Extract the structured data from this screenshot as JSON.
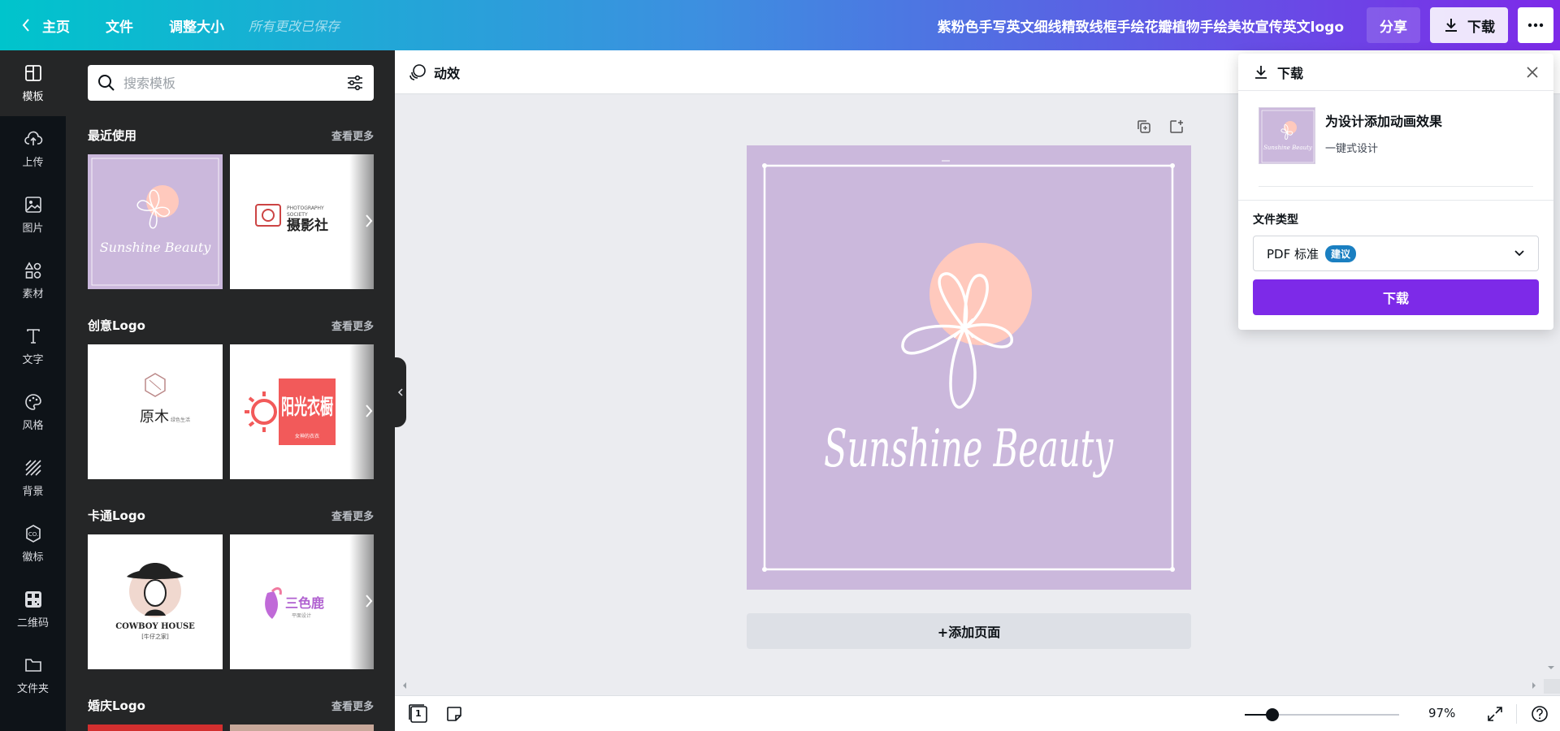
{
  "topbar": {
    "home": "主页",
    "file": "文件",
    "resize": "调整大小",
    "saved": "所有更改已保存",
    "doc_title": "紫粉色手写英文细线精致线框手绘花瓣植物手绘美妆宣传英文logo",
    "share": "分享",
    "download": "下载",
    "more_icon": "more-icon"
  },
  "rail": {
    "items": [
      {
        "label": "模板",
        "icon": "template-icon"
      },
      {
        "label": "上传",
        "icon": "upload-icon"
      },
      {
        "label": "图片",
        "icon": "image-icon"
      },
      {
        "label": "素材",
        "icon": "elements-icon"
      },
      {
        "label": "文字",
        "icon": "text-icon"
      },
      {
        "label": "风格",
        "icon": "palette-icon"
      },
      {
        "label": "背景",
        "icon": "background-icon"
      },
      {
        "label": "徽标",
        "icon": "logo-icon"
      },
      {
        "label": "二维码",
        "icon": "qrcode-icon"
      },
      {
        "label": "文件夹",
        "icon": "folder-icon"
      }
    ]
  },
  "panel": {
    "search_placeholder": "搜索模板",
    "see_more": "查看更多",
    "sections": [
      {
        "title": "最近使用",
        "thumbs": [
          {
            "text": "Sunshine Beauty"
          },
          {
            "text": "PHOTOGRAPHY",
            "sub": "SOCIETY",
            "main": "摄影社"
          }
        ]
      },
      {
        "title": "创意Logo",
        "thumbs": [
          {
            "text": "原木",
            "sub": "绿色生活"
          },
          {
            "text": "阳光衣橱",
            "sub": "女神的衣衣"
          }
        ]
      },
      {
        "title": "卡通Logo",
        "thumbs": [
          {
            "text": "COWBOY HOUSE",
            "sub": "[牛仔之家]"
          },
          {
            "text": "三色鹿",
            "sub": "平面设计"
          }
        ]
      },
      {
        "title": "婚庆Logo",
        "thumbs": []
      }
    ]
  },
  "toolbar": {
    "animate": "动效"
  },
  "design": {
    "text": "Sunshine Beauty",
    "bg_color": "#cbb8dc",
    "blob_color": "#ffc9bd"
  },
  "add_page": "+添加页面",
  "bottombar": {
    "page_number": "1",
    "zoom_value": 97,
    "zoom_text": "97%"
  },
  "download_panel": {
    "title": "下载",
    "anim_title": "为设计添加动画效果",
    "anim_sub": "一键式设计",
    "file_type_label": "文件类型",
    "file_type": "PDF 标准",
    "badge": "建议",
    "button": "下载"
  },
  "colors": {
    "accent": "#7d2ae8",
    "badge": "#1a7fc1"
  }
}
